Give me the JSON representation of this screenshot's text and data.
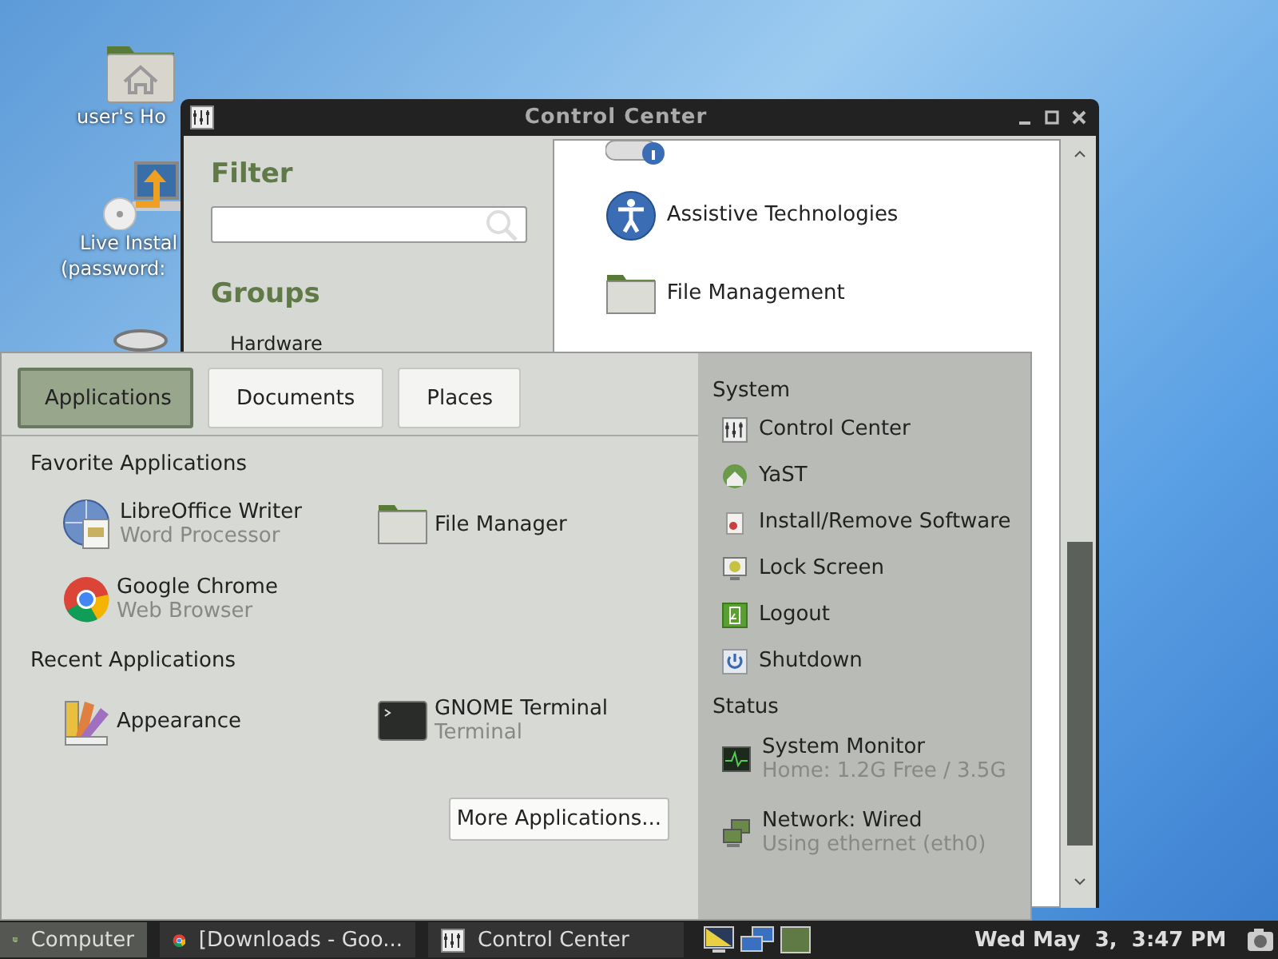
{
  "desktop_icons": [
    {
      "kind": "home",
      "lines": [
        "user's Ho"
      ]
    },
    {
      "kind": "installer",
      "lines": [
        "Live Instal",
        "(password:"
      ]
    },
    {
      "kind": "trash"
    }
  ],
  "window": {
    "title": "Control Center",
    "filter_heading": "Filter",
    "groups_heading": "Groups",
    "groups": [
      "Hardware"
    ],
    "items": [
      {
        "kind": "accessibility",
        "label": "Assistive Technologies"
      },
      {
        "kind": "folder",
        "label": "File Management"
      }
    ]
  },
  "menu": {
    "tabs": [
      {
        "label": "Applications",
        "selected": true
      },
      {
        "label": "Documents",
        "selected": false
      },
      {
        "label": "Places",
        "selected": false
      }
    ],
    "sections": [
      {
        "heading": "Favorite Applications",
        "apps": [
          {
            "kind": "writer",
            "name": "LibreOffice Writer",
            "description": "Word Processor"
          },
          {
            "kind": "folder",
            "name": "File Manager"
          },
          {
            "kind": "chrome",
            "name": "Google Chrome",
            "description": "Web Browser"
          }
        ]
      },
      {
        "heading": "Recent Applications",
        "apps": [
          {
            "kind": "palette",
            "name": "Appearance"
          },
          {
            "kind": "terminal",
            "name": "GNOME Terminal",
            "description": "Terminal"
          }
        ]
      }
    ],
    "more_button": "More Applications...",
    "side_sections": [
      {
        "heading": "System",
        "items": [
          {
            "kind": "control",
            "label": "Control Center"
          },
          {
            "kind": "yast",
            "label": "YaST"
          },
          {
            "kind": "package",
            "label": "Install/Remove Software"
          },
          {
            "kind": "lock",
            "label": "Lock Screen"
          },
          {
            "kind": "logout",
            "label": "Logout"
          },
          {
            "kind": "power",
            "label": "Shutdown"
          }
        ]
      },
      {
        "heading": "Status",
        "items": [
          {
            "kind": "monitor",
            "label": "System Monitor",
            "detail": "Home: 1.2G Free / 3.5G"
          },
          {
            "kind": "network",
            "label": "Network: Wired",
            "detail": "Using ethernet (eth0)"
          }
        ]
      }
    ]
  },
  "taskbar": {
    "start": {
      "label": "Computer",
      "selected": true
    },
    "tasks": [
      {
        "kind": "chrome",
        "label": "[Downloads - Goo...",
        "selected": false
      },
      {
        "kind": "control",
        "label": "Control Center",
        "selected": false
      }
    ],
    "clock": "Wed May  3,  3:47 PM"
  }
}
